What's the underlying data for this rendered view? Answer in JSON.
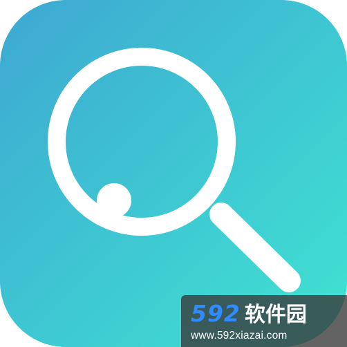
{
  "app_icon": {
    "icon": "magnifier-icon",
    "gradient_start": "#3EA8D2",
    "gradient_end": "#3FE3D2",
    "glyph_color": "#FFFFFF"
  },
  "watermark": {
    "site_number": "592",
    "site_name": "软件园",
    "site_url": "www.592xiazai.com",
    "number_color": "#2F8BFF",
    "background": "#3A3A3A"
  }
}
